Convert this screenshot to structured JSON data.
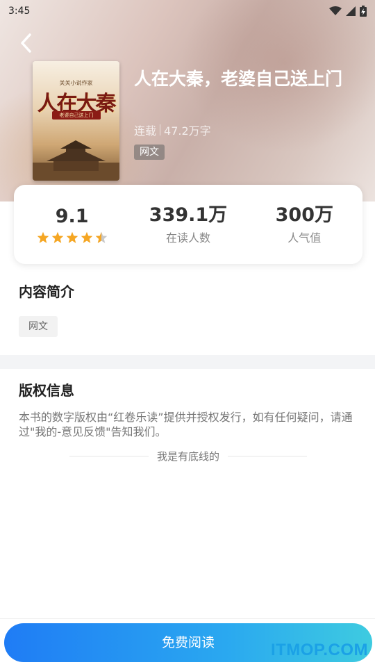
{
  "status_bar": {
    "time": "3:45"
  },
  "book": {
    "title": "人在大秦，老婆自己送上门",
    "status": "连载",
    "word_count": "47.2万字",
    "category_tag": "网文",
    "cover": {
      "top_text": "关关小说作家",
      "title_text": "人在大秦",
      "sub_text": "老婆自己送上门"
    }
  },
  "stats": {
    "rating": "9.1",
    "rating_stars": 4.5,
    "readers_value": "339.1万",
    "readers_label": "在读人数",
    "popularity_value": "300万",
    "popularity_label": "人气值"
  },
  "intro": {
    "heading": "内容简介",
    "tag": "网文"
  },
  "copyright": {
    "heading": "版权信息",
    "text": "本书的数字版权由“红卷乐读”提供并授权发行，如有任何疑问，请通过\"我的-意见反馈\"告知我们。",
    "bottom_line": "我是有底线的"
  },
  "actions": {
    "read_button": "免费阅读"
  },
  "watermark": "ITMOP.COM",
  "colors": {
    "accent_blue": "#1f7cf5",
    "star_orange": "#f5a623",
    "watermark_blue": "#1ba1e6"
  }
}
